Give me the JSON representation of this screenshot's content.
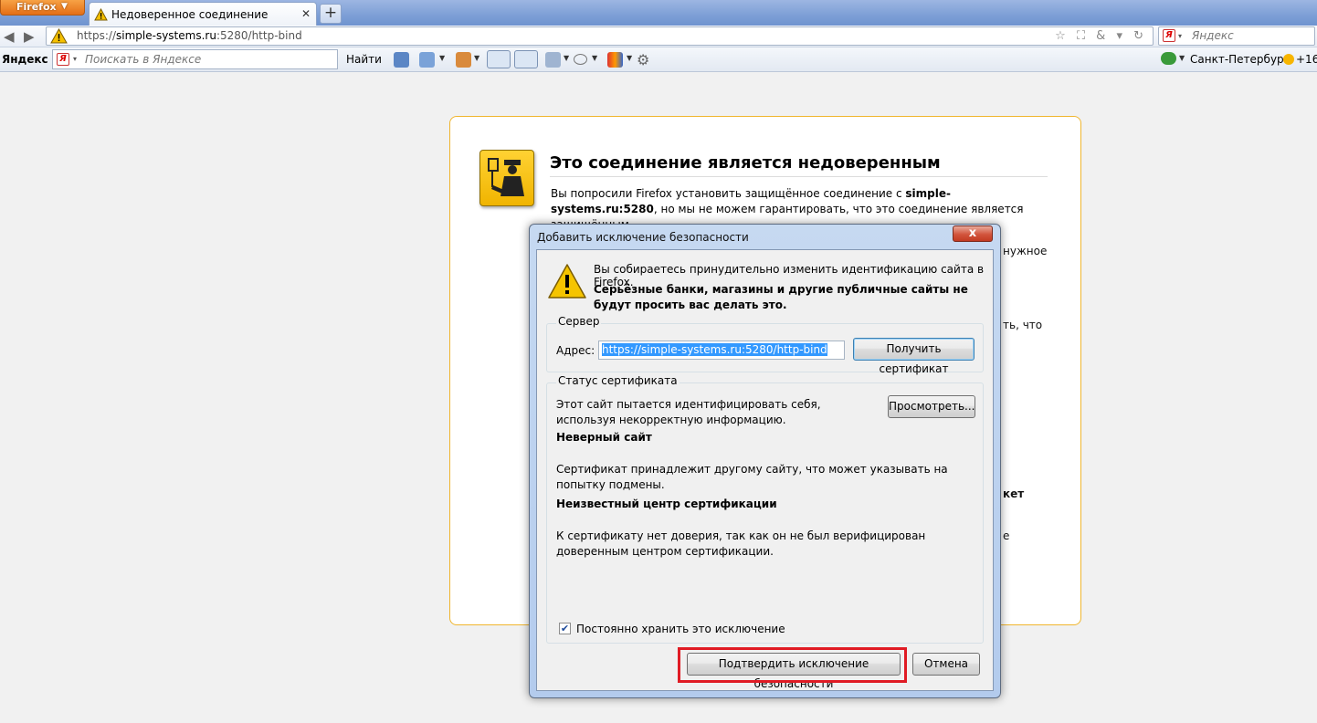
{
  "browser": {
    "menu_button": "Firefox",
    "tab": {
      "title": "Недоверенное соединение"
    },
    "newtab_label": "+",
    "url": {
      "scheme": "https://",
      "domain": "simple-systems.ru",
      "rest": ":5280/http-bind"
    },
    "search_placeholder": "Яндекс"
  },
  "yandex_bar": {
    "logo": "Яндекс",
    "search_placeholder": "Поискать в Яндексе",
    "find_label": "Найти",
    "city": "Санкт-Петербург",
    "temperature": "+16"
  },
  "page": {
    "title": "Это соединение является недоверенным",
    "text_part1": "Вы попросили Firefox установить защищённое соединение с ",
    "text_domain": "simple-systems.ru:5280",
    "text_part2": ", но мы не можем гарантировать, что это соединение является защищённым.",
    "peek_1": "нужное",
    "peek_2": "ть, что",
    "peek_3": "кет",
    "peek_4": "е"
  },
  "dialog": {
    "title": "Добавить исключение безопасности",
    "close_label": "x",
    "message": "Вы собираетесь принудительно изменить идентификацию сайта в Firefox.",
    "warning": "Серьёзные банки, магазины и другие публичные сайты не будут просить вас делать это.",
    "server_group": "Сервер",
    "address_label": "Адрес:",
    "address_value": "https://simple-systems.ru:5280/http-bind",
    "get_cert_button": "Получить сертификат",
    "status_group": "Статус сертификата",
    "status_text": "Этот сайт пытается идентифицировать себя, используя некорректную информацию.",
    "view_button": "Просмотреть...",
    "wrong_site_heading": "Неверный сайт",
    "wrong_site_text": "Сертификат принадлежит другому сайту, что может указывать на попытку подмены.",
    "unknown_ca_heading": "Неизвестный центр сертификации",
    "unknown_ca_text": "К сертификату нет доверия, так как он не был верифицирован доверенным центром сертификации.",
    "keep_checkbox_label": "Постоянно хранить это исключение",
    "keep_checked": true,
    "confirm_button": "Подтвердить исключение безопасности",
    "cancel_button": "Отмена"
  },
  "colors": {
    "highlight": "#e01b24",
    "card_border": "#f0b62f",
    "selection": "#3399ff"
  }
}
